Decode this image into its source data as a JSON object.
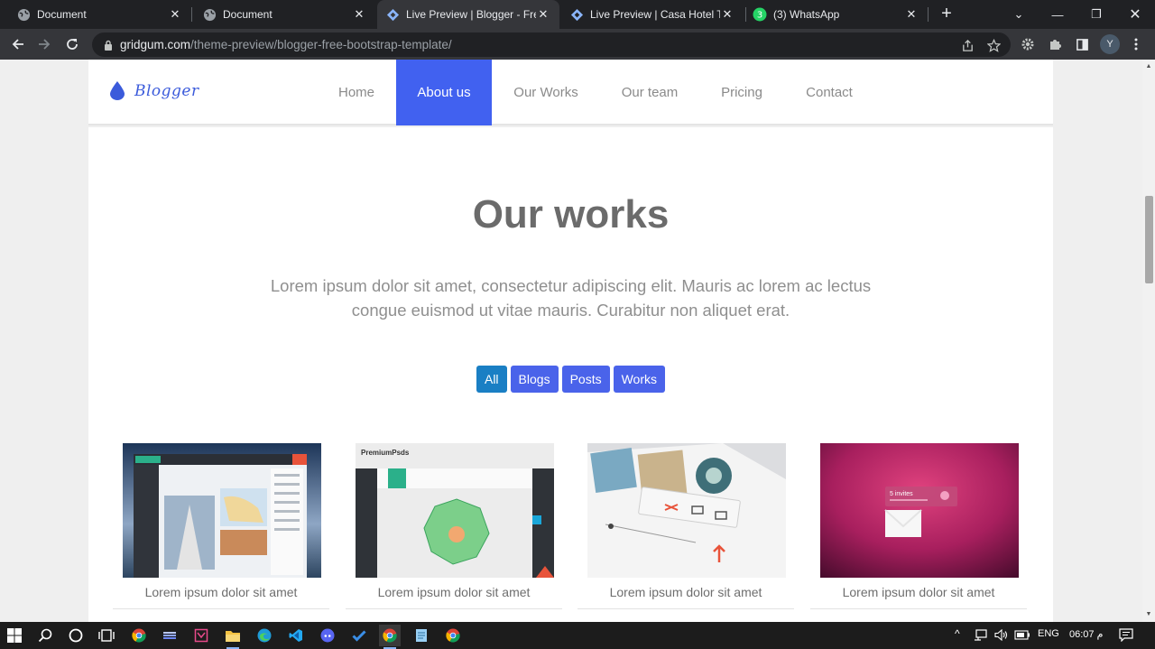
{
  "browser": {
    "tabs": [
      {
        "title": "Document",
        "icon": "globe-icon",
        "active": false
      },
      {
        "title": "Document",
        "icon": "globe-icon",
        "active": false
      },
      {
        "title": "Live Preview | Blogger - Free",
        "icon": "gridgum-icon",
        "active": true
      },
      {
        "title": "Live Preview | Casa Hotel The",
        "icon": "gridgum-icon",
        "active": false
      },
      {
        "title": "(3) WhatsApp",
        "icon": "whatsapp-icon",
        "active": false
      }
    ],
    "url_host": "gridgum.com",
    "url_path": "/theme-preview/blogger-free-bootstrap-template/",
    "profile_initial": "Y"
  },
  "site": {
    "brand": "Blogger",
    "nav": [
      {
        "label": "Home",
        "active": false
      },
      {
        "label": "About us",
        "active": true
      },
      {
        "label": "Our Works",
        "active": false
      },
      {
        "label": "Our team",
        "active": false
      },
      {
        "label": "Pricing",
        "active": false
      },
      {
        "label": "Contact",
        "active": false
      }
    ],
    "section_title": "Our works",
    "section_desc": "Lorem ipsum dolor sit amet, consectetur adipiscing elit. Mauris ac lorem ac lectus congue euismod ut vitae mauris. Curabitur non aliquet erat.",
    "filters": [
      {
        "label": "All",
        "active": true
      },
      {
        "label": "Blogs",
        "active": false
      },
      {
        "label": "Posts",
        "active": false
      },
      {
        "label": "Works",
        "active": false
      }
    ],
    "works": [
      {
        "caption": "Lorem ipsum dolor sit amet",
        "thumb": "dashboard-app"
      },
      {
        "caption": "Lorem ipsum dolor sit amet",
        "thumb": "premiumpsds-chart",
        "thumb_title": "PremiumPsds"
      },
      {
        "caption": "Lorem ipsum dolor sit amet",
        "thumb": "music-player"
      },
      {
        "caption": "Lorem ipsum dolor sit amet",
        "thumb": "invites-card",
        "thumb_text": "5 invites"
      }
    ]
  },
  "taskbar": {
    "language": "ENG",
    "time": "06:07 م"
  },
  "colors": {
    "accent": "#4161f0",
    "filter_active": "#1a7fc4",
    "tab_bg": "#202124",
    "toolbar_bg": "#35363a"
  }
}
